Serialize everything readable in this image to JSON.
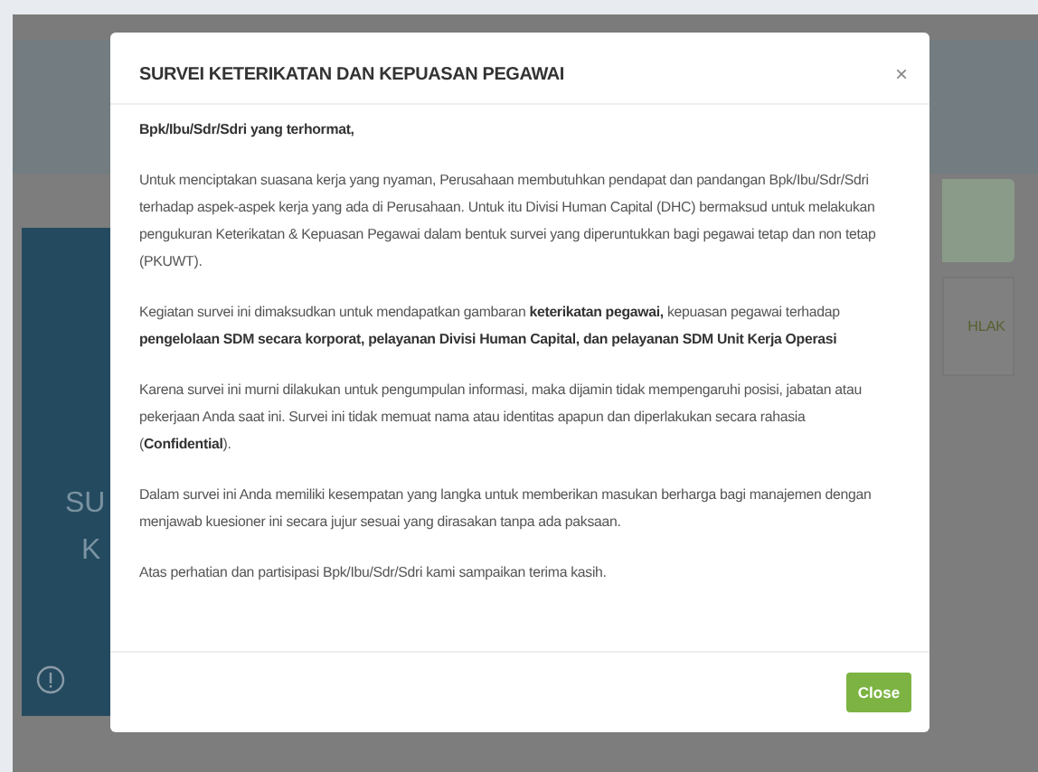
{
  "background": {
    "card_text": [
      "SU",
      "K"
    ],
    "side_text": "HLAK"
  },
  "modal": {
    "title": "SURVEI KETERIKATAN DAN KEPUASAN PEGAWAI",
    "close_icon": "×",
    "greeting": "Bpk/Ibu/Sdr/Sdri yang terhormat,",
    "paragraphs": [
      "Untuk menciptakan suasana kerja yang nyaman, Perusahaan membutuhkan pendapat dan pandangan Bpk/Ibu/Sdr/Sdri terhadap aspek-aspek kerja yang ada di Perusahaan. Untuk itu Divisi Human Capital (DHC) bermaksud untuk melakukan pengukuran Keterikatan & Kepuasan Pegawai dalam bentuk survei yang diperuntukkan bagi pegawai tetap dan non tetap (PKUWT).",
      "Kegiatan survei ini dimaksudkan untuk mendapatkan gambaran **keterikatan pegawai,** kepuasan pegawai terhadap **pengelolaan SDM secara korporat, pelayanan Divisi Human Capital, dan pelayanan SDM Unit Kerja Operasi**",
      "Karena survei ini murni dilakukan untuk pengumpulan informasi, maka dijamin tidak mempengaruhi posisi, jabatan atau pekerjaan Anda saat ini. Survei ini tidak memuat nama atau identitas apapun dan diperlakukan secara rahasia (**Confidential**).",
      "Dalam survei ini Anda memiliki kesempatan yang langka untuk memberikan masukan berharga bagi manajemen dengan menjawab kuesioner ini secara jujur sesuai yang dirasakan tanpa ada paksaan.",
      "Atas perhatian dan partisipasi Bpk/Ibu/Sdr/Sdri kami sampaikan terima kasih."
    ],
    "button": "Close"
  }
}
